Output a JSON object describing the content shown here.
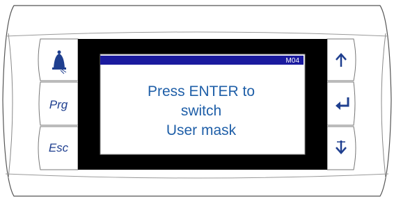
{
  "left_buttons": {
    "alarm_icon": "bell-icon",
    "prg_label": "Prg",
    "esc_label": "Esc"
  },
  "right_buttons": {
    "up_icon": "arrow-up-icon",
    "enter_icon": "enter-return-icon",
    "down_icon": "arrow-down-icon"
  },
  "display": {
    "mask_code": "M04",
    "lines": [
      "Press ENTER to",
      "switch",
      "User mask"
    ]
  },
  "colors": {
    "title_bar": "#1a1a9e",
    "text": "#1f5fa8",
    "icon_blue": "#1f3f8f",
    "bezel": "#000000"
  }
}
